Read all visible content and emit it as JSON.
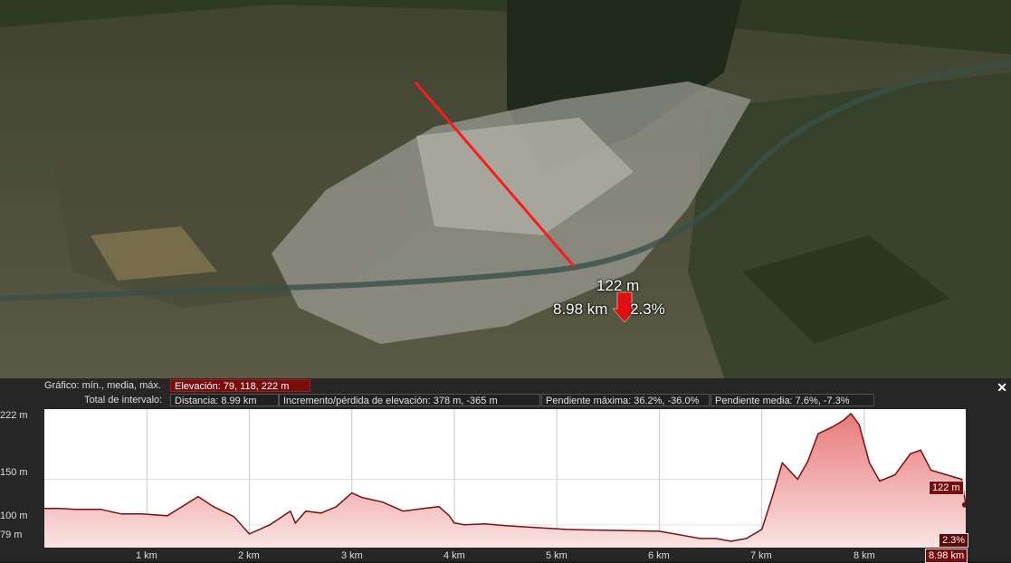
{
  "map": {
    "marker": {
      "elevation": "122 m",
      "distance": "8.98 km",
      "slope": "2.3%"
    }
  },
  "panel": {
    "graph_label": "Gráfico: mín., media, máx.",
    "elevation_stat": "Elevación: 79, 118, 222 m",
    "interval_label": "Total de intervalo:",
    "distance_stat": "Distancia: 8.99 km",
    "gain_loss_stat": "Incremento/pérdida de elevación: 378 m, -365 m",
    "max_slope_stat": "Pendiente máxima: 36.2%, -36.0%",
    "avg_slope_stat": "Pendiente media: 7.6%, -7.3%",
    "close_icon": "close-icon"
  },
  "chart_data": {
    "type": "area",
    "x": [
      0,
      0.15,
      0.3,
      0.55,
      0.75,
      0.95,
      1.2,
      1.5,
      1.65,
      1.85,
      2.0,
      2.2,
      2.4,
      2.45,
      2.55,
      2.7,
      2.85,
      3.0,
      3.1,
      3.3,
      3.5,
      3.7,
      3.85,
      3.95,
      4.0,
      4.1,
      4.3,
      4.5,
      4.8,
      5.1,
      5.5,
      6.0,
      6.4,
      6.55,
      6.7,
      6.85,
      7.0,
      7.1,
      7.2,
      7.35,
      7.45,
      7.55,
      7.7,
      7.8,
      7.87,
      7.95,
      8.05,
      8.15,
      8.3,
      8.45,
      8.55,
      8.65,
      8.8,
      8.95,
      8.99
    ],
    "y": [
      118,
      118,
      117,
      117,
      112,
      112,
      110,
      131,
      120,
      109,
      90,
      100,
      115,
      102,
      115,
      113,
      120,
      135,
      130,
      125,
      115,
      118,
      120,
      110,
      102,
      100,
      101,
      99,
      97,
      95,
      94,
      93,
      85,
      85,
      82,
      85,
      95,
      130,
      168,
      150,
      170,
      200,
      208,
      215,
      222,
      210,
      168,
      148,
      155,
      178,
      182,
      160,
      155,
      150,
      122
    ],
    "ylabel": "",
    "xlabel": "",
    "y_ticks": [
      "222 m",
      "150 m",
      "100 m",
      "79 m"
    ],
    "x_ticks": [
      "1 km",
      "2 km",
      "3 km",
      "4 km",
      "5 km",
      "6 km",
      "7 km",
      "8 km"
    ],
    "xlim": [
      0,
      8.99
    ],
    "ylim": [
      75,
      227
    ],
    "grid": true,
    "cursor": {
      "distance": "8.98 km",
      "elevation": "122 m",
      "slope": "2.3%"
    },
    "colors": {
      "line": "#7a1010",
      "fill": "#f4b6b6",
      "cursor": "#7a0c0c"
    }
  }
}
